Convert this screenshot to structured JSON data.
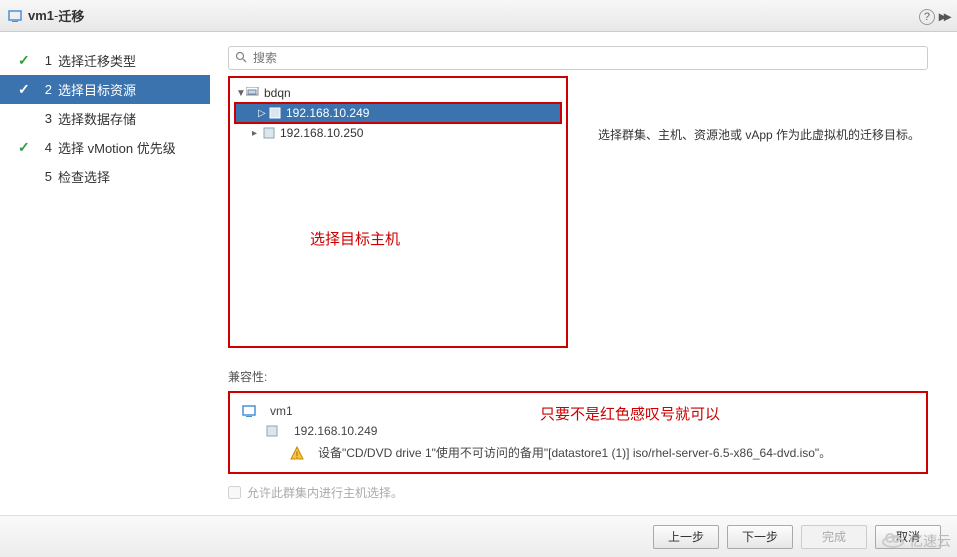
{
  "title": {
    "vm": "vm1",
    "sep": " - ",
    "action": "迁移"
  },
  "steps": [
    {
      "num": "1",
      "label": "选择迁移类型",
      "checked": true,
      "current": false
    },
    {
      "num": "2",
      "label": "选择目标资源",
      "checked": true,
      "current": true
    },
    {
      "num": "3",
      "label": "选择数据存储",
      "checked": false,
      "current": false
    },
    {
      "num": "4",
      "label": "选择 vMotion 优先级",
      "checked": true,
      "current": false
    },
    {
      "num": "5",
      "label": "检查选择",
      "checked": false,
      "current": false
    }
  ],
  "search": {
    "placeholder": "搜索"
  },
  "tree": {
    "root": "bdqn",
    "children": [
      {
        "label": "192.168.10.249",
        "selected": true
      },
      {
        "label": "192.168.10.250",
        "selected": false
      }
    ],
    "caption": "选择目标主机"
  },
  "instruction": "选择群集、主机、资源池或 vApp 作为此虚拟机的迁移目标。",
  "compat": {
    "label": "兼容性:",
    "vm": "vm1",
    "host": "192.168.10.249",
    "warning": "设备\"CD/DVD drive 1\"使用不可访问的备用\"[datastore1 (1)] iso/rhel-server-6.5-x86_64-dvd.iso\"。",
    "annotation": "只要不是红色感叹号就可以"
  },
  "allow": "允许此群集内进行主机选择。",
  "buttons": {
    "back": "上一步",
    "next": "下一步",
    "finish": "完成",
    "cancel": "取消"
  },
  "watermark": "亿速云"
}
